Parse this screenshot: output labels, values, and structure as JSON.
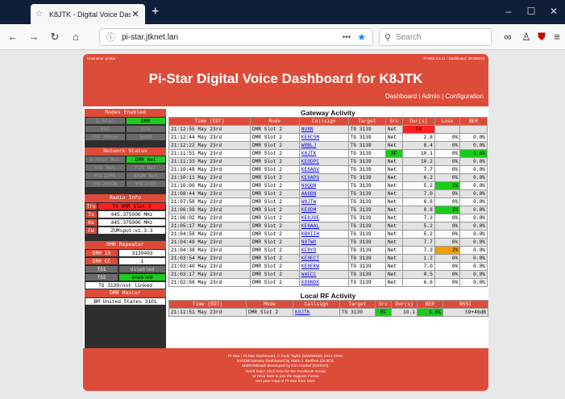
{
  "browser": {
    "tab_title": "K8JTK - Digital Voice Dashboard",
    "url": "pi-star.jtknet.lan",
    "search_placeholder": "Search"
  },
  "header": {
    "hostname": "Hostname: pi-star",
    "version": "Pi-Star:3.4.11 / Dashboard: 20180519",
    "title": "Pi-Star Digital Voice Dashboard for K8JTK",
    "links": [
      "Dashboard",
      "Admin",
      "Configuration"
    ]
  },
  "sidebar": {
    "modes_title": "Modes Enabled",
    "modes": [
      [
        "D-Star",
        "DMR"
      ],
      [
        "YSF",
        "P25"
      ],
      [
        "YSF XMode",
        "NXDN"
      ]
    ],
    "network_title": "Network Status",
    "network": [
      [
        "D-Star Net",
        "DMR Net"
      ],
      [
        "YSF Net",
        "P25 Net"
      ],
      [
        "YSF2DMR",
        "NXDN Net"
      ],
      [
        "YSF2NXDN",
        "YSF2P25"
      ]
    ],
    "radio_title": "Radio Info",
    "radio": [
      {
        "label": "Trx",
        "value": "TX DMR Slot 2"
      },
      {
        "label": "Tx",
        "value": "445.375000 MHz"
      },
      {
        "label": "Rx",
        "value": "445.375000 MHz"
      },
      {
        "label": "FW",
        "value": "ZUMspot:v1.3.3"
      }
    ],
    "dmr_title": "DMR Repeater",
    "dmr": [
      {
        "label": "DMR ID",
        "value": "3139403"
      },
      {
        "label": "DMR CC",
        "value": "1"
      },
      {
        "label": "TS1",
        "value": "disabled"
      },
      {
        "label": "TS2",
        "value": "enabled"
      }
    ],
    "tg_status": "TG 3139/not linked",
    "master_title": "DMR Master",
    "master": "BM United States 3101"
  },
  "gateway": {
    "title": "Gateway Activity",
    "columns": [
      "Time (EDT)",
      "Mode",
      "Callsign",
      "Target",
      "Src",
      "Dur(s)",
      "Loss",
      "BER"
    ],
    "rows": [
      [
        "21:12:55 May 23rd",
        "DMR Slot 2",
        "NU8N",
        "TG 3139",
        "Net",
        "TX",
        "",
        ""
      ],
      [
        "21:12:44 May 23rd",
        "DMR Slot 2",
        "KE8CSM",
        "TG 3139",
        "Net",
        "2.8",
        "0%",
        "0.0%"
      ],
      [
        "21:12:22 May 23rd",
        "DMR Slot 2",
        "W8BLJ",
        "TG 3139",
        "Net",
        "8.4",
        "0%",
        "0.0%"
      ],
      [
        "21:11:51 May 23rd",
        "DMR Slot 2",
        "K8JTK",
        "TG 3139",
        "RF",
        "10.1",
        "0%",
        "1.6%"
      ],
      [
        "21:11:33 May 23rd",
        "DMR Slot 2",
        "KE8DPC",
        "TG 3139",
        "Net",
        "10.2",
        "0%",
        "0.0%"
      ],
      [
        "21:10:48 May 23rd",
        "DMR Slot 2",
        "KE8AGV",
        "TG 3139",
        "Net",
        "7.7",
        "0%",
        "0.0%"
      ],
      [
        "21:10:11 May 23rd",
        "DMR Slot 2",
        "KE8APG",
        "TG 3139",
        "Net",
        "6.2",
        "0%",
        "0.0%"
      ],
      [
        "21:10:00 May 23rd",
        "DMR Slot 2",
        "N8QQN",
        "TG 3139",
        "Net",
        "5.2",
        "1%",
        "0.0%"
      ],
      [
        "21:08:44 May 23rd",
        "DMR Slot 2",
        "AA8BN",
        "TG 3139",
        "Net",
        "7.0",
        "0%",
        "0.0%"
      ],
      [
        "21:07:58 May 23rd",
        "DMR Slot 2",
        "W8JTW",
        "TG 3139",
        "Net",
        "6.6",
        "0%",
        "0.0%"
      ],
      [
        "21:06:39 May 23rd",
        "DMR Slot 2",
        "KE8DM",
        "TG 3139",
        "Net",
        "8.8",
        "1%",
        "0.0%"
      ],
      [
        "21:06:02 May 23rd",
        "DMR Slot 2",
        "KE8JGE",
        "TG 3139",
        "Net",
        "7.3",
        "0%",
        "0.0%"
      ],
      [
        "21:05:17 May 23rd",
        "DMR Slot 2",
        "KE8AAL",
        "TG 3139",
        "Net",
        "5.2",
        "0%",
        "0.0%"
      ],
      [
        "21:04:58 May 23rd",
        "DMR Slot 2",
        "KB8IIH",
        "TG 3139",
        "Net",
        "5.2",
        "0%",
        "0.0%"
      ],
      [
        "21:04:49 May 23rd",
        "DMR Slot 2",
        "N8TWU",
        "TG 3139",
        "Net",
        "7.7",
        "0%",
        "0.0%"
      ],
      [
        "21:04:38 May 23rd",
        "DMR Slot 2",
        "KF8YO",
        "TG 3139",
        "Net",
        "7.3",
        "2%",
        "0.0%"
      ],
      [
        "21:03:54 May 23rd",
        "DMR Slot 2",
        "KE8ECT",
        "TG 3139",
        "Net",
        "1.2",
        "0%",
        "0.0%"
      ],
      [
        "21:03:40 May 23rd",
        "DMR Slot 2",
        "KE8EKW",
        "TG 3139",
        "Net",
        "7.0",
        "0%",
        "0.0%"
      ],
      [
        "21:03:17 May 23rd",
        "DMR Slot 2",
        "W4FCC",
        "TG 3139",
        "Net",
        "0.5",
        "0%",
        "0.0%"
      ],
      [
        "21:02:56 May 23rd",
        "DMR Slot 2",
        "KD8NDX",
        "TG 3139",
        "Net",
        "6.6",
        "0%",
        "0.0%"
      ]
    ]
  },
  "localrf": {
    "title": "Local RF Activity",
    "columns": [
      "Time (EDT)",
      "Mode",
      "Callsign",
      "Target",
      "Src",
      "Dur(s)",
      "BER",
      "RSSI"
    ],
    "rows": [
      [
        "21:11:51 May 23rd",
        "DMR Slot 2",
        "K8JTK",
        "TG 3139",
        "RF",
        "10.1",
        "1.6%",
        "S9+46dB"
      ]
    ]
  },
  "footer": {
    "lines": [
      "Pi-Star / Pi-Star Dashboard, © Andy Taylor (MW0MWZ) 2014-2018.",
      "ircDDBGateway Dashboard by Hans-J. Barthen (DL5DI),",
      "MMDVMDash developed by Kim Huebel (DG9VH),",
      "Need help? Click here for the Facebook Group",
      "or Click here to join the Support Forum",
      "Get your copy of Pi-Star from here."
    ]
  },
  "colors": {
    "accent": "#dd4b39",
    "active": "#1bcc1b",
    "alert": "#ff2020",
    "inactive": "#6b6b6b"
  }
}
